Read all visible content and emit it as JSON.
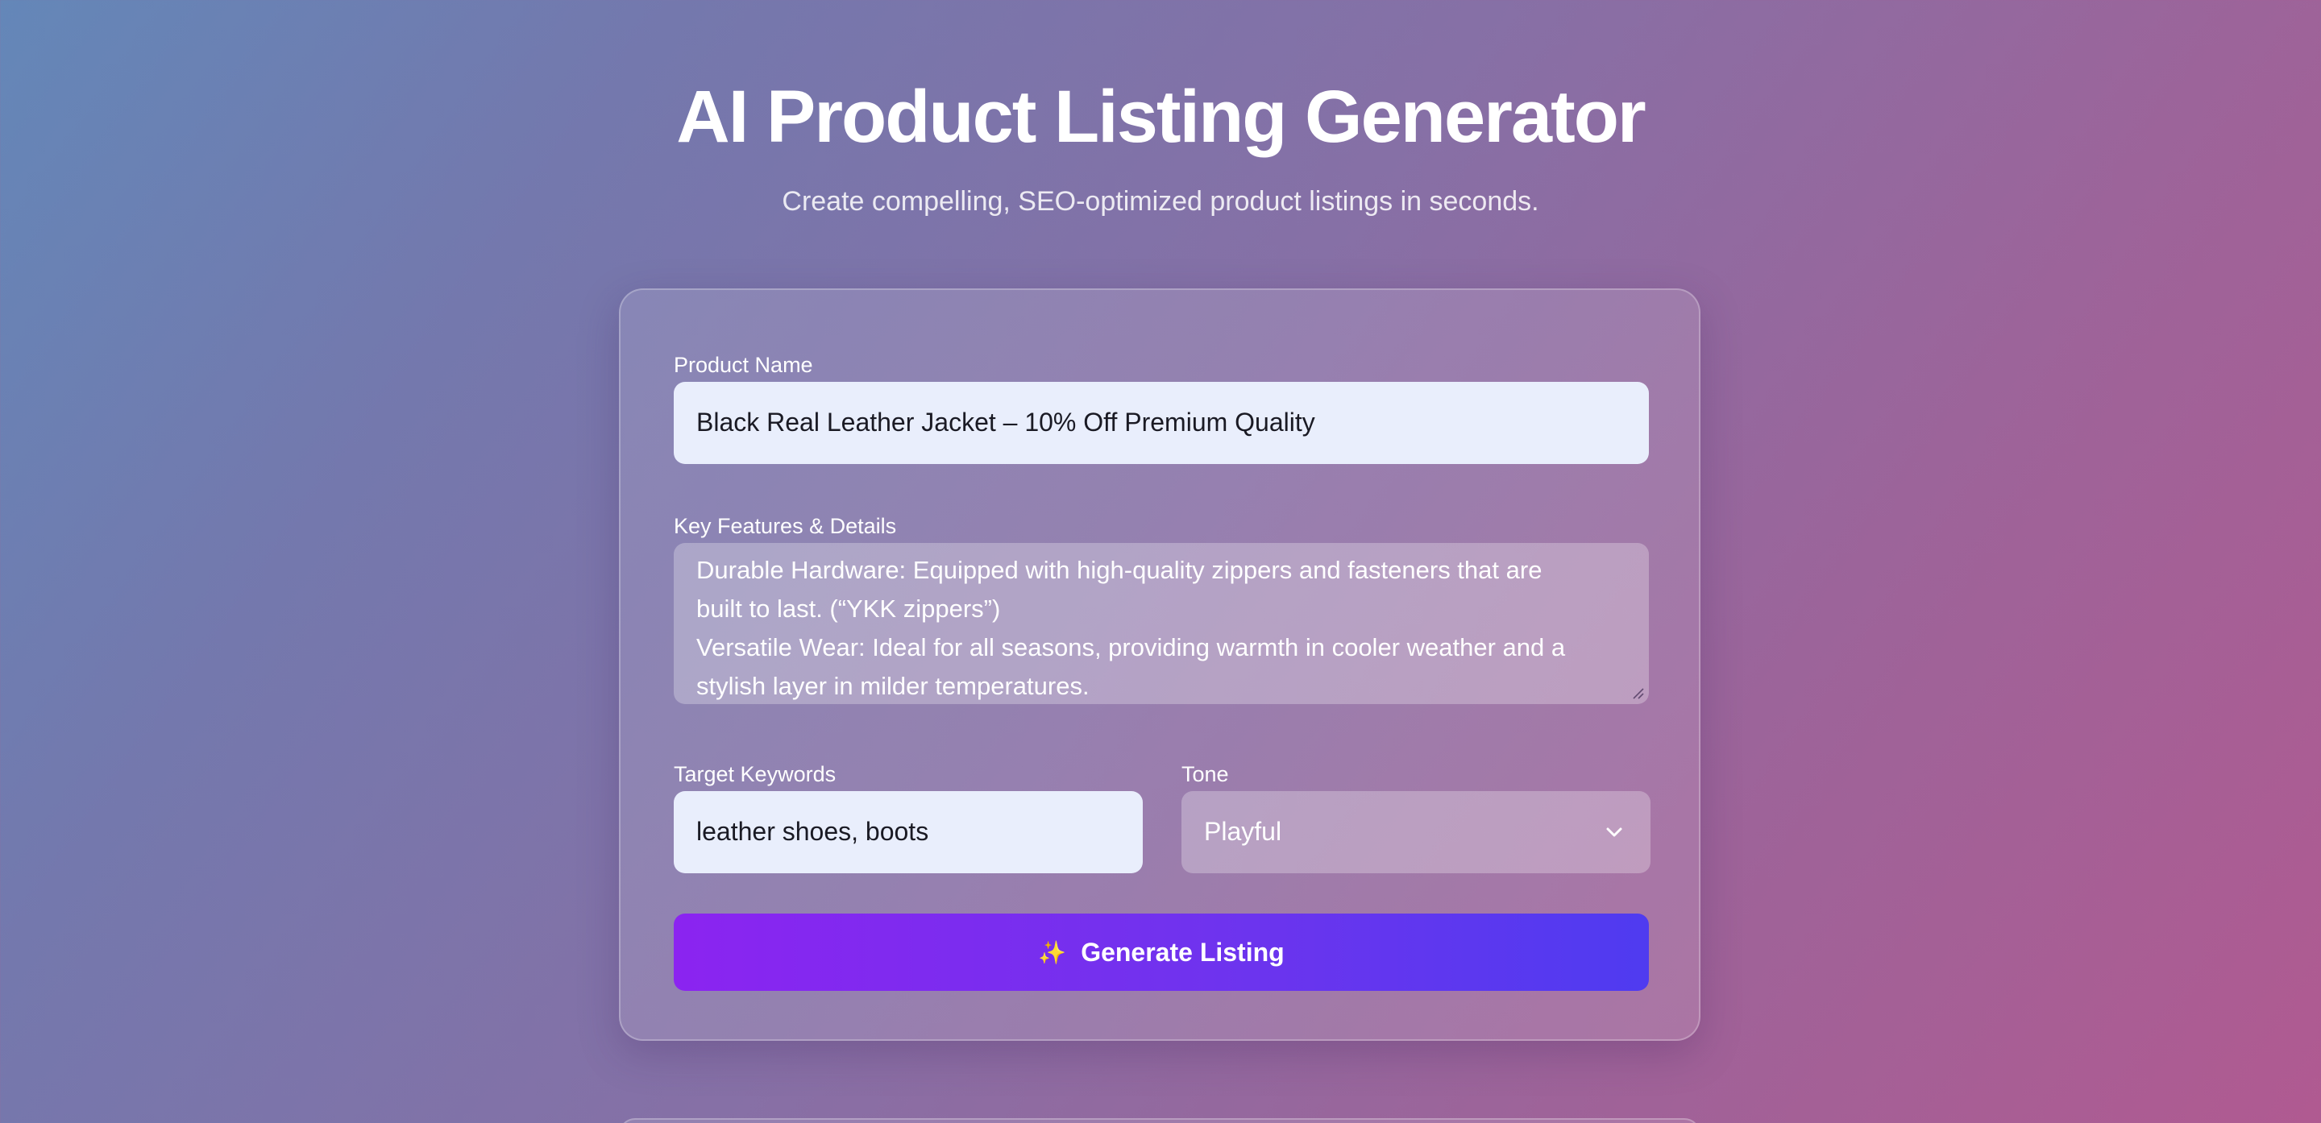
{
  "header": {
    "title": "AI Product Listing Generator",
    "subtitle": "Create compelling, SEO-optimized product listings in seconds."
  },
  "form": {
    "product_name": {
      "label": "Product Name",
      "value": "Black Real Leather Jacket – 10% Off Premium Quality"
    },
    "features": {
      "label": "Key Features & Details",
      "lines": [
        "Durable Hardware: Equipped with high-quality zippers and fasteners that are",
        "built to last. (“YKK zippers”)",
        "Versatile Wear: Ideal for all seasons, providing warmth in cooler weather and a",
        "stylish layer in milder temperatures."
      ]
    },
    "keywords": {
      "label": "Target Keywords",
      "value": "leather shoes, boots"
    },
    "tone": {
      "label": "Tone",
      "selected": "Playful"
    },
    "generate_button": {
      "icon": "sparkles-icon",
      "label": "Generate Listing"
    }
  },
  "colors": {
    "button_start": "#8b24f0",
    "button_end": "#4f3bf0",
    "input_background": "#e9eefc"
  }
}
